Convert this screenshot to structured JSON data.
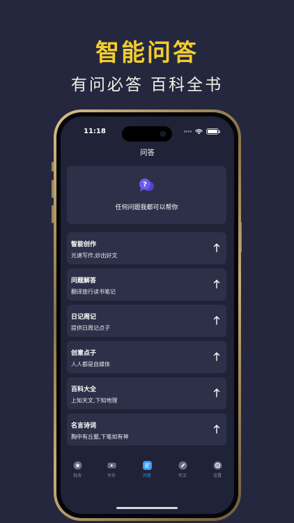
{
  "promo": {
    "headline": "智能问答",
    "subline": "有问必答 百科全书"
  },
  "status_bar": {
    "time": "11:18",
    "battery_level": 1.0
  },
  "nav": {
    "title": "问答"
  },
  "hero": {
    "icon": "chat-bubbles-icon",
    "text": "任何问题我都可以帮你"
  },
  "features": [
    {
      "title": "智能创作",
      "subtitle": "光速写作,妙出好文",
      "icon": "arrow-up-icon"
    },
    {
      "title": "问题解答",
      "subtitle": "翻译旅行读书笔记",
      "icon": "arrow-up-icon"
    },
    {
      "title": "日记周记",
      "subtitle": "提供日周记点子",
      "icon": "arrow-up-icon"
    },
    {
      "title": "创意点子",
      "subtitle": "人人都是自媒体",
      "icon": "arrow-up-icon"
    },
    {
      "title": "百科大全",
      "subtitle": "上知天文,下知地理",
      "icon": "arrow-up-icon"
    },
    {
      "title": "名言诗词",
      "subtitle": "胸中有丘壑,下笔如有神",
      "icon": "arrow-up-icon"
    }
  ],
  "tabs": [
    {
      "label": "批改",
      "icon": "star-badge-icon",
      "active": false
    },
    {
      "label": "写作",
      "icon": "video-icon",
      "active": false
    },
    {
      "label": "问答",
      "icon": "chat-icon",
      "active": true
    },
    {
      "label": "作文",
      "icon": "pencil-icon",
      "active": false
    },
    {
      "label": "设置",
      "icon": "gear-icon",
      "active": false
    }
  ],
  "colors": {
    "background": "#25273f",
    "headline": "#f2cd2e",
    "card": "#2d3048",
    "accent": "#3a9ff5",
    "hero_icon": "#6a5cf0"
  }
}
